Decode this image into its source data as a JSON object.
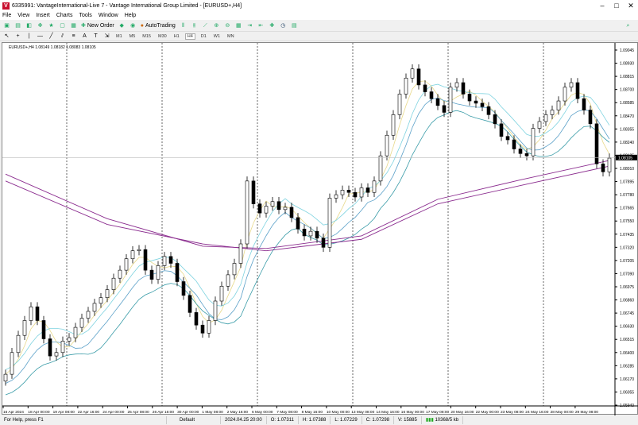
{
  "window": {
    "title": "6335991: VantageInternational-Live 7 - Vantage International Group Limited - [EURUSD+,H4]"
  },
  "menu": [
    "File",
    "View",
    "Insert",
    "Charts",
    "Tools",
    "Window",
    "Help"
  ],
  "toolbar": {
    "new_order": "New Order",
    "autotrading": "AutoTrading"
  },
  "timeframes": [
    "M1",
    "M5",
    "M15",
    "M30",
    "H1",
    "H4",
    "D1",
    "W1",
    "MN"
  ],
  "active_timeframe": "H4",
  "chart": {
    "header": "EURUSD+,H4  1.08149 1.08182 1.08083 1.08105",
    "current_price": "1.08105"
  },
  "status": {
    "help": "For Help, press F1",
    "profile": "Default",
    "time": "2024.04.25 20:00",
    "open": "O: 1.07311",
    "high": "H: 1.07388",
    "low": "L: 1.07229",
    "close": "C: 1.07298",
    "volume": "V: 15885",
    "traffic": "10368/5 kb"
  },
  "colors": {
    "bull": "#ffffff",
    "bear": "#000000",
    "ma_purple": "#8b2d8f",
    "ma_cyan": "#7fd3e0",
    "ma_teal": "#3a9ca8",
    "ma_yellow": "#e8d98a",
    "ma_blue": "#5aa0c8"
  },
  "chart_data": {
    "type": "candlestick",
    "symbol": "EURUSD+",
    "timeframe": "H4",
    "ylim": [
      1.0594,
      1.09045
    ],
    "y_ticks": [
      "1.09045",
      "1.08930",
      "1.08815",
      "1.08700",
      "1.08585",
      "1.08470",
      "1.08355",
      "1.08240",
      "1.08125",
      "1.08010",
      "1.07895",
      "1.07780",
      "1.07665",
      "1.07550",
      "1.07435",
      "1.07320",
      "1.07205",
      "1.07090",
      "1.06975",
      "1.06860",
      "1.06745",
      "1.06630",
      "1.06515",
      "1.06400",
      "1.06285",
      "1.06170",
      "1.06055",
      "1.05940"
    ],
    "x_ticks": [
      "16 Apr 2024",
      "18 Apr 00:00",
      "19 Apr 08:00",
      "22 Apr 16:00",
      "24 Apr 00:00",
      "25 Apr 08:00",
      "26 Apr 16:00",
      "30 Apr 00:00",
      "1 May 08:00",
      "2 May 16:00",
      "6 May 00:00",
      "7 May 08:00",
      "8 May 16:00",
      "10 May 00:00",
      "13 May 08:00",
      "14 May 16:00",
      "16 May 00:00",
      "17 May 08:00",
      "20 May 16:00",
      "22 May 00:00",
      "23 May 08:00",
      "24 May 16:00",
      "28 May 00:00",
      "29 May 08:00"
    ],
    "closes": [
      1.0621,
      1.064,
      1.0655,
      1.0668,
      1.068,
      1.0668,
      1.0652,
      1.0637,
      1.064,
      1.065,
      1.0653,
      1.0662,
      1.067,
      1.0676,
      1.0683,
      1.0688,
      1.0695,
      1.0705,
      1.0712,
      1.0722,
      1.0729,
      1.073,
      1.0712,
      1.0704,
      1.0716,
      1.0724,
      1.0718,
      1.0702,
      1.069,
      1.0675,
      1.0664,
      1.0657,
      1.0668,
      1.0685,
      1.0698,
      1.0708,
      1.0718,
      1.0735,
      1.079,
      1.077,
      1.0762,
      1.0768,
      1.0772,
      1.0765,
      1.0767,
      1.0758,
      1.0748,
      1.0742,
      1.0746,
      1.074,
      1.0732,
      1.0775,
      1.0778,
      1.0782,
      1.078,
      1.0776,
      1.0784,
      1.078,
      1.079,
      1.0812,
      1.083,
      1.0848,
      1.0866,
      1.088,
      1.0888,
      1.0874,
      1.0868,
      1.0862,
      1.0856,
      1.085,
      1.0872,
      1.0876,
      1.0866,
      1.086,
      1.0858,
      1.0855,
      1.0848,
      1.084,
      1.0829,
      1.0826,
      1.0818,
      1.0814,
      1.0812,
      1.0836,
      1.0842,
      1.0848,
      1.0852,
      1.086,
      1.0872,
      1.0876,
      1.0862,
      1.0852,
      1.084,
      1.0805,
      1.0798,
      1.081
    ],
    "long_ma": [
      {
        "points": [
          [
            0,
            1.0796
          ],
          [
            16,
            1.0757
          ],
          [
            31,
            1.0733
          ],
          [
            41,
            1.0731
          ],
          [
            56,
            1.0742
          ],
          [
            68,
            1.0774
          ],
          [
            81,
            1.0791
          ],
          [
            95,
            1.0808
          ]
        ]
      },
      {
        "points": [
          [
            0,
            1.079
          ],
          [
            16,
            1.0752
          ],
          [
            31,
            1.0735
          ],
          [
            41,
            1.0729
          ],
          [
            56,
            1.0739
          ],
          [
            68,
            1.077
          ],
          [
            81,
            1.0786
          ],
          [
            95,
            1.0803
          ]
        ]
      }
    ]
  }
}
